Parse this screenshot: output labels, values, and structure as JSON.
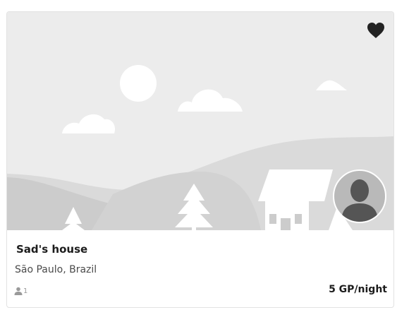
{
  "listing": {
    "title": "Sad's house",
    "location": "São Paulo, Brazil",
    "guest_count": "1",
    "price": "5 GP/night",
    "favorite_icon": "heart-icon",
    "favorited": true,
    "photo_icon": "landscape-placeholder-icon",
    "host_avatar_icon": "default-user-silhouette-icon",
    "guests_icon": "person-icon"
  },
  "colors": {
    "card_border": "#e2e2e2",
    "placeholder_bg": "#ececec",
    "placeholder_shape": "#ffffff",
    "hill_far": "#dadada",
    "hill_near": "#cccccc",
    "favorite_heart": "#222222",
    "avatar_bg": "#b9b9b9",
    "avatar_silhouette": "#555555",
    "muted_text": "#9a9a9a"
  }
}
